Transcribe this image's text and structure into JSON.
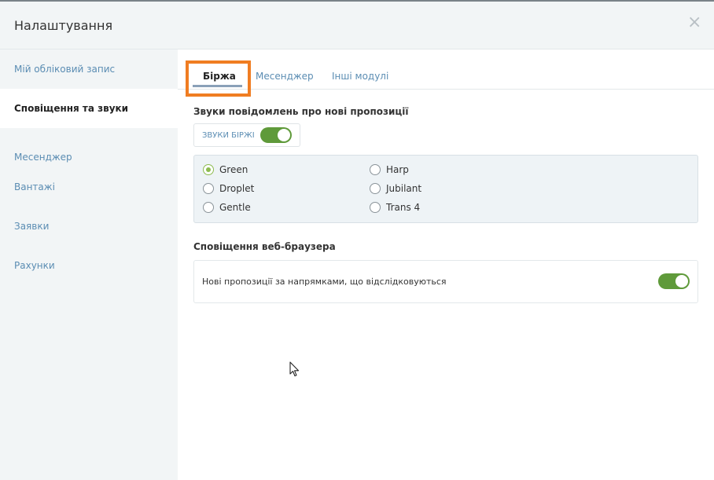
{
  "header": {
    "title": "Налаштування",
    "close_icon": "close-icon"
  },
  "sidebar": {
    "items": [
      {
        "label": "Мій обліковий запис",
        "active": false
      },
      {
        "label": "Сповіщення та звуки",
        "active": true
      },
      {
        "label": "Месенджер",
        "active": false
      },
      {
        "label": "Вантажі",
        "active": false
      },
      {
        "label": "Заявки",
        "active": false
      },
      {
        "label": "Рахунки",
        "active": false
      }
    ]
  },
  "tabs": [
    {
      "label": "Біржа",
      "active": true
    },
    {
      "label": "Месенджер",
      "active": false
    },
    {
      "label": "Інші модулі",
      "active": false
    }
  ],
  "sounds": {
    "title": "Звуки повідомлень про нові пропозиції",
    "toggle_label": "ЗВУКИ БІРЖІ",
    "toggle_on": true,
    "options": [
      {
        "label": "Green",
        "checked": true
      },
      {
        "label": "Droplet",
        "checked": false
      },
      {
        "label": "Gentle",
        "checked": false
      },
      {
        "label": "Harp",
        "checked": false
      },
      {
        "label": "Jubilant",
        "checked": false
      },
      {
        "label": "Trans 4",
        "checked": false
      }
    ]
  },
  "browser": {
    "title": "Сповіщення веб-браузера",
    "item_label": "Нові пропозиції за напрямками, що відслідковуються",
    "toggle_on": true
  },
  "colors": {
    "accent_green": "#5f9a3a",
    "radio_green": "#8dbb4f",
    "link_blue": "#5b8db3",
    "highlight_orange": "#f07d22"
  }
}
